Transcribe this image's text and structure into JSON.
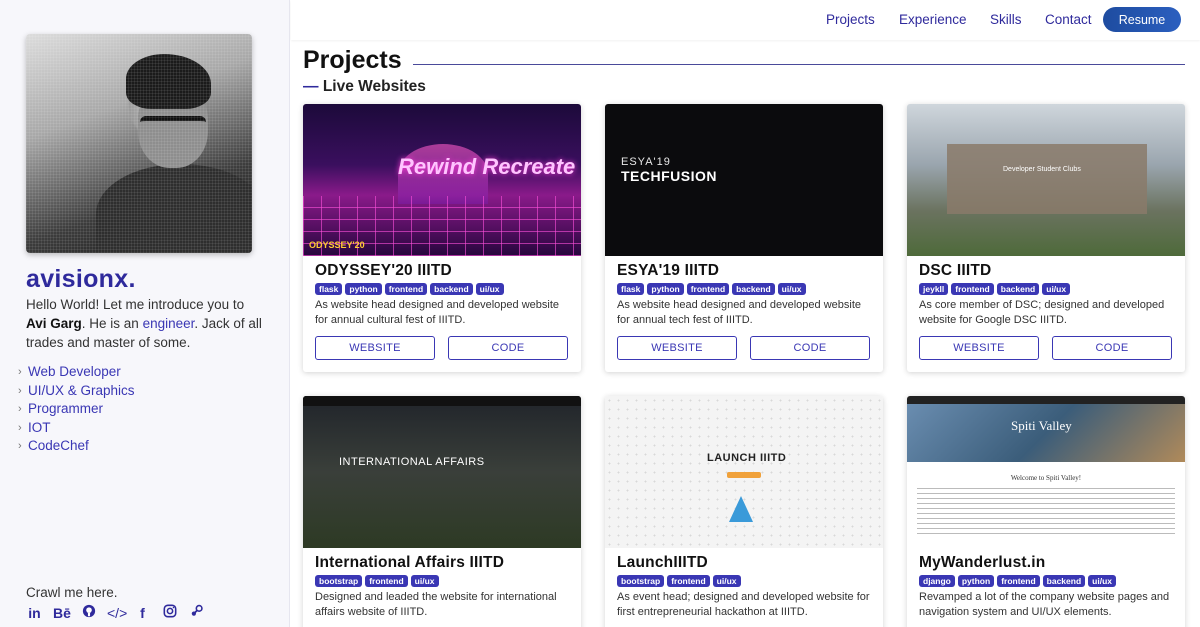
{
  "sidebar": {
    "brand": "avisionx.",
    "intro_pre": "Hello World! Let me introduce you to",
    "intro_name": "Avi Garg",
    "intro_mid": ". He is an",
    "intro_link": "engineer",
    "intro_post": ". Jack of all trades and master of some.",
    "roles": [
      "Web Developer",
      "UI/UX & Graphics",
      "Programmer",
      "IOT",
      "CodeChef"
    ],
    "crawl_label": "Crawl me here.",
    "social_icons": [
      "linkedin-icon",
      "behance-icon",
      "github-icon",
      "code-icon",
      "facebook-icon",
      "instagram-icon",
      "steam-icon"
    ]
  },
  "nav": {
    "items": [
      "Projects",
      "Experience",
      "Skills",
      "Contact"
    ],
    "resume": "Resume"
  },
  "main": {
    "heading": "Projects",
    "subheading": "Live Websites",
    "website_label": "WEBSITE",
    "code_label": "CODE"
  },
  "projects": [
    {
      "title": "ODYSSEY'20 IIITD",
      "tags": [
        "flask",
        "python",
        "frontend",
        "backend",
        "ui/ux"
      ],
      "description": "As website head designed and developed website for annual cultural fest of IIITD.",
      "thumb_text": "Rewind Recreate",
      "thumb_foot": "ODYSSEY'20"
    },
    {
      "title": "ESYA'19 IIITD",
      "tags": [
        "flask",
        "python",
        "frontend",
        "backend",
        "ui/ux"
      ],
      "description": "As website head designed and developed website for annual tech fest of IIITD.",
      "thumb_text": "ESYA'19",
      "thumb_text2": "TECHFUSION"
    },
    {
      "title": "DSC IIITD",
      "tags": [
        "jeykll",
        "frontend",
        "backend",
        "ui/ux"
      ],
      "description": "As core member of DSC; designed and developed website for Google DSC IIITD.",
      "thumb_text": "Developer Student Clubs"
    },
    {
      "title": "International Affairs IIITD",
      "tags": [
        "bootstrap",
        "frontend",
        "ui/ux"
      ],
      "description": "Designed and leaded the website for international affairs website of IIITD.",
      "thumb_text": "INTERNATIONAL AFFAIRS"
    },
    {
      "title": "LaunchIIITD",
      "tags": [
        "bootstrap",
        "frontend",
        "ui/ux"
      ],
      "description": "As event head; designed and developed website for first entrepreneurial hackathon at IIITD.",
      "thumb_text": "LAUNCH IIITD"
    },
    {
      "title": "MyWanderlust.in",
      "tags": [
        "django",
        "python",
        "frontend",
        "backend",
        "ui/ux"
      ],
      "description": "Revamped a lot of the company website pages and navigation system and UI/UX elements.",
      "thumb_text": "Spiti Valley",
      "thumb_text2": "Welcome to Spiti Valley!"
    }
  ],
  "colors": {
    "accent": "#2f2a9c",
    "tag_bg": "#3a37b4",
    "resume_bg": "#1e4ca0"
  }
}
